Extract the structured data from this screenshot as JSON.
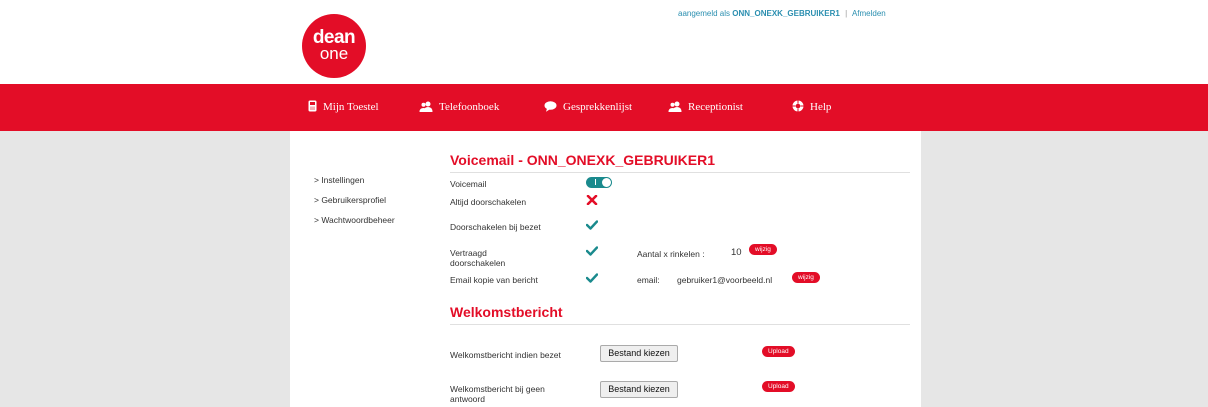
{
  "brand": {
    "logo_line1": "dean",
    "logo_line2": "one",
    "color": "#e30d27"
  },
  "account": {
    "prefix": "aangemeld als",
    "username": "ONN_ONEXK_GEBRUIKER1",
    "separator": "|",
    "logout": "Afmelden"
  },
  "nav": [
    {
      "label": "Mijn Toestel",
      "icon": "phone-icon"
    },
    {
      "label": "Telefoonboek",
      "icon": "users-icon"
    },
    {
      "label": "Gesprekkenlijst",
      "icon": "chat-bubble-icon"
    },
    {
      "label": "Receptionist",
      "icon": "receptionist-icon"
    },
    {
      "label": "Help",
      "icon": "lifebuoy-icon"
    }
  ],
  "sidebar": [
    {
      "label": "> Instellingen"
    },
    {
      "label": "> Gebruikersprofiel"
    },
    {
      "label": "> Wachtwoordbeheer"
    }
  ],
  "voicemail": {
    "title": "Voicemail - ONN_ONEXK_GEBRUIKER1",
    "rows": [
      {
        "label": "Voicemail",
        "state": "toggle-on"
      },
      {
        "label": "Altijd doorschakelen",
        "state": "off"
      },
      {
        "label": "Doorschakelen bij bezet",
        "state": "on"
      },
      {
        "label": "Vertraagd doorschakelen",
        "state": "on",
        "extra_label": "Aantal x rinkelen :",
        "extra_value": "10",
        "action": "wijzig"
      },
      {
        "label": "Email kopie van bericht",
        "state": "on",
        "extra_label": "email:",
        "extra_value": "gebruiker1@voorbeeld.nl",
        "action": "wijzig"
      }
    ]
  },
  "welcome": {
    "title": "Welkomstbericht",
    "rows": [
      {
        "label": "Welkomstbericht indien bezet",
        "file_button": "Bestand kiezen",
        "upload": "Upload"
      },
      {
        "label": "Welkomstbericht bij geen antwoord",
        "file_button": "Bestand kiezen",
        "upload": "Upload"
      }
    ]
  }
}
